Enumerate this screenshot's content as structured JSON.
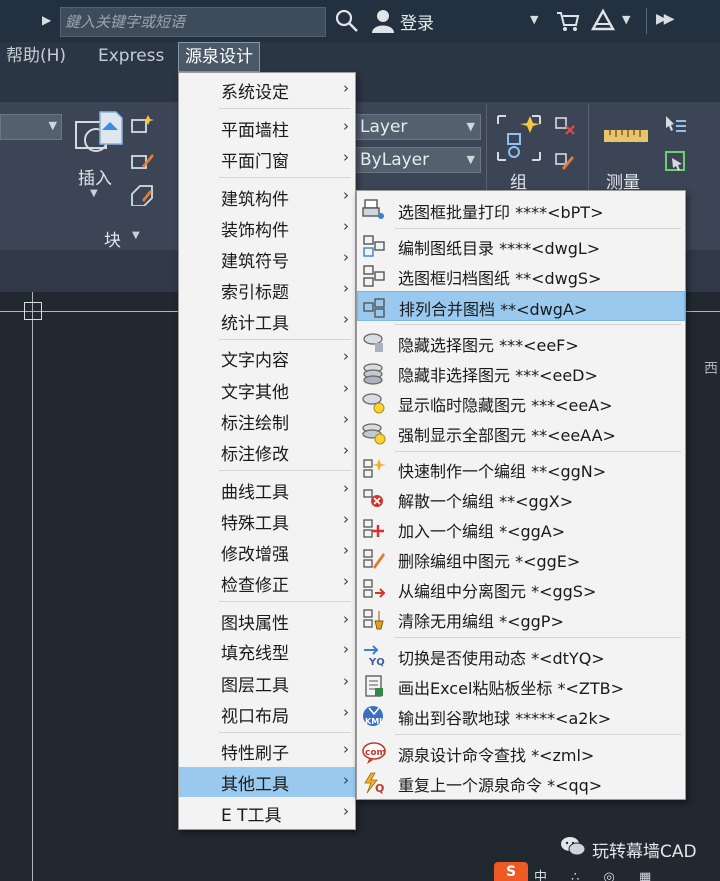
{
  "titlebar": {
    "search_placeholder": "鍵入关键字或短语",
    "login": "登录"
  },
  "menubar": {
    "items": [
      {
        "label": "帮助(H)"
      },
      {
        "label": "Express"
      },
      {
        "label": "源泉设计"
      }
    ]
  },
  "ribbon": {
    "insert_label": "插入",
    "block_label": "块",
    "layer_value_1": "Layer",
    "layer_value_2": "ByLayer",
    "group_label": "组",
    "measure_label": "测量"
  },
  "canvas": {
    "edge_label": "西"
  },
  "taskbar": {
    "orange_label": "S",
    "bits": "中 ∴ ◎ ▦"
  },
  "watermark": {
    "text": "玩转幕墙CAD"
  },
  "menu_main": {
    "items": [
      {
        "label": "系统设定"
      },
      {
        "label": "平面墙柱"
      },
      {
        "label": "平面门窗"
      },
      {
        "label": "建筑构件"
      },
      {
        "label": "装饰构件"
      },
      {
        "label": "建筑符号"
      },
      {
        "label": "索引标题"
      },
      {
        "label": "统计工具"
      },
      {
        "label": "文字内容"
      },
      {
        "label": "文字其他"
      },
      {
        "label": "标注绘制"
      },
      {
        "label": "标注修改"
      },
      {
        "label": "曲线工具"
      },
      {
        "label": "特殊工具"
      },
      {
        "label": "修改增强"
      },
      {
        "label": "检查修正"
      },
      {
        "label": "图块属性"
      },
      {
        "label": "填充线型"
      },
      {
        "label": "图层工具"
      },
      {
        "label": "视口布局"
      },
      {
        "label": "特性刷子"
      },
      {
        "label": "其他工具",
        "highlighted": true
      },
      {
        "label": "E T工具"
      }
    ]
  },
  "menu_sub": {
    "items": [
      {
        "label": "选图框批量打印    ****<bPT>",
        "icon": "batch-print-icon"
      },
      {
        "label": "编制图纸目录    ****<dwgL>",
        "icon": "drawing-list-icon"
      },
      {
        "label": "选图框归档图纸    **<dwgS>",
        "icon": "archive-drawing-icon"
      },
      {
        "label": "排列合并图档    **<dwgA>",
        "icon": "merge-drawing-icon",
        "highlighted": true
      },
      {
        "label": "隐藏选择图元    ***<eeF>",
        "icon": "hide-selected-icon"
      },
      {
        "label": "隐藏非选择图元    ***<eeD>",
        "icon": "hide-unselected-icon"
      },
      {
        "label": "显示临时隐藏图元 ***<eeA>",
        "icon": "show-hidden-icon"
      },
      {
        "label": "强制显示全部图元 **<eeAA>",
        "icon": "show-all-icon"
      },
      {
        "label": "快速制作一个编组    **<ggN>",
        "icon": "quick-group-icon"
      },
      {
        "label": "解散一个编组    **<ggX>",
        "icon": "ungroup-icon"
      },
      {
        "label": "加入一个编组    *<ggA>",
        "icon": "join-group-icon"
      },
      {
        "label": "删除编组中图元    *<ggE>",
        "icon": "delete-from-group-icon"
      },
      {
        "label": "从编组中分离图元    *<ggS>",
        "icon": "separate-group-icon"
      },
      {
        "label": "清除无用编组    *<ggP>",
        "icon": "purge-group-icon"
      },
      {
        "label": "切换是否使用动态    *<dtYQ>",
        "icon": "toggle-dynamic-icon"
      },
      {
        "label": "画出Excel粘贴板坐标 *<ZTB>",
        "icon": "excel-coord-icon"
      },
      {
        "label": "输出到谷歌地球    *****<a2k>",
        "icon": "kml-export-icon"
      },
      {
        "label": "源泉设计命令查找    *<zml>",
        "icon": "command-search-icon"
      },
      {
        "label": "重复上一个源泉命令    *<qq>",
        "icon": "repeat-command-icon"
      }
    ]
  }
}
